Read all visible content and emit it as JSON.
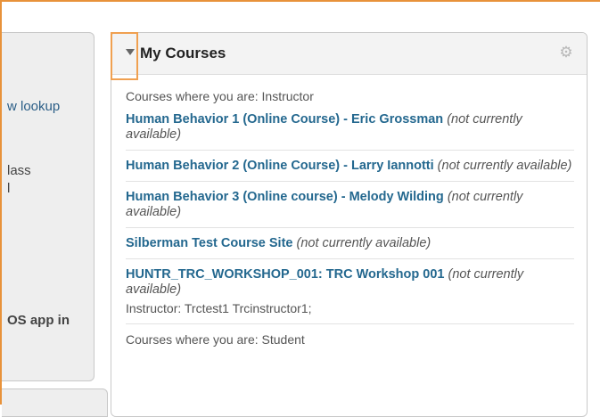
{
  "left_fragments": [
    "w lookup",
    "lass",
    "l",
    "OS app in"
  ],
  "module": {
    "title": "My Courses",
    "instructor_label": "Courses where you are: Instructor",
    "student_label": "Courses where you are: Student",
    "courses": [
      {
        "name": "Human Behavior 1 (Online Course) - Eric Grossman",
        "status": "(not currently available)"
      },
      {
        "name": "Human Behavior 2 (Online Course) - Larry Iannotti",
        "status": "(not currently available)"
      },
      {
        "name": "Human Behavior 3 (Online course) - Melody Wilding",
        "status": "(not currently available)"
      },
      {
        "name": "Silberman Test Course Site",
        "status": "(not currently available)"
      },
      {
        "name": "HUNTR_TRC_WORKSHOP_001: TRC Workshop 001",
        "status": "(not currently available)",
        "instructor_label": "Instructor:",
        "instructor_name": "Trctest1 Trcinstructor1;"
      }
    ]
  },
  "colors": {
    "link": "#24688f",
    "highlight": "#f0a050"
  }
}
